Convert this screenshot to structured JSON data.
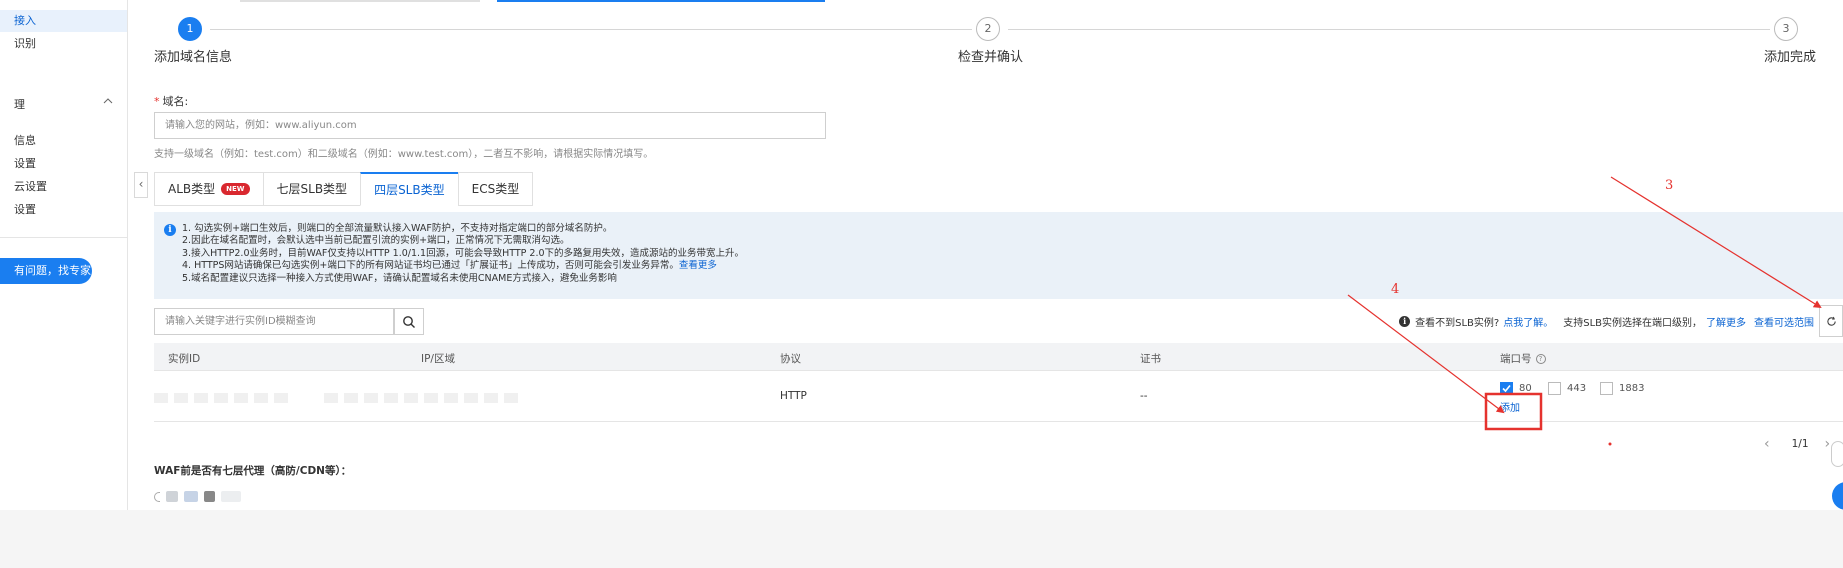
{
  "sidebar": {
    "items": [
      {
        "label": "接入",
        "active": true
      },
      {
        "label": "识别",
        "active": false
      }
    ],
    "group": {
      "label": "理"
    },
    "sub_items": [
      {
        "label": "信息"
      },
      {
        "label": "设置"
      },
      {
        "label": "云设置"
      },
      {
        "label": "设置"
      }
    ],
    "expert_button": "有问题，找专家"
  },
  "steps": [
    {
      "number": "1",
      "label": "添加域名信息",
      "state": "active"
    },
    {
      "number": "2",
      "label": "检查并确认",
      "state": "idle"
    },
    {
      "number": "3",
      "label": "添加完成",
      "state": "idle"
    }
  ],
  "domain": {
    "label": "域名:",
    "required_mark": "*",
    "placeholder": "请输入您的网站，例如：www.aliyun.com",
    "hint": "支持一级域名（例如：test.com）和二级域名（例如：www.test.com），二者互不影响，请根据实际情况填写。"
  },
  "type_tabs": [
    {
      "label": "ALB类型",
      "badge": "NEW",
      "active": false
    },
    {
      "label": "七层SLB类型",
      "active": false
    },
    {
      "label": "四层SLB类型",
      "active": true
    },
    {
      "label": "ECS类型",
      "active": false
    }
  ],
  "notice": {
    "icon": "info-icon",
    "lines": [
      "1. 勾选实例+端口生效后，则端口的全部流量默认接入WAF防护，不支持对指定端口的部分域名防护。",
      "2.因此在域名配置时，会默认选中当前已配置引流的实例+端口，正常情况下无需取消勾选。",
      "3.接入HTTP2.0业务时，目前WAF仅支持以HTTP 1.0/1.1回源，可能会导致HTTP 2.0下的多路复用失效，造成源站的业务带宽上升。",
      "4. HTTPS网站请确保已勾选实例+端口下的所有网站证书均已通过「扩展证书」上传成功，否则可能会引发业务异常。",
      "5.域名配置建议只选择一种接入方式使用WAF，请确认配置域名未使用CNAME方式接入，避免业务影响"
    ],
    "link": "查看更多"
  },
  "search": {
    "placeholder": "请输入关键字进行实例ID模糊查询",
    "icon": "search-icon"
  },
  "right_tools": {
    "question": "查看不到SLB实例?",
    "link1": "点我了解。",
    "text2": "支持SLB实例选择在端口级别，",
    "link2": "了解更多",
    "link3": "查看可选范围",
    "refresh_icon": "refresh-icon"
  },
  "table": {
    "columns": [
      "实例ID",
      "IP/区域",
      "协议",
      "证书",
      "端口号"
    ],
    "rows": [
      {
        "protocol": "HTTP",
        "certificate": "--",
        "ports": [
          {
            "port": "80",
            "checked": true
          },
          {
            "port": "443",
            "checked": false
          },
          {
            "port": "1883",
            "checked": false
          }
        ],
        "add_label": "添加"
      }
    ]
  },
  "pagination": {
    "current": "1/1"
  },
  "proxy_question": "WAF前是否有七层代理（高防/CDN等）：",
  "annotations": [
    {
      "number": "3",
      "color": "#e5322e"
    },
    {
      "number": "4",
      "color": "#e5322e"
    }
  ],
  "colors": {
    "primary": "#1a7ef0",
    "link": "#0a63d2",
    "badge": "#d9282f",
    "annotation": "#e5322e",
    "notice_bg": "#eaf1f8"
  }
}
